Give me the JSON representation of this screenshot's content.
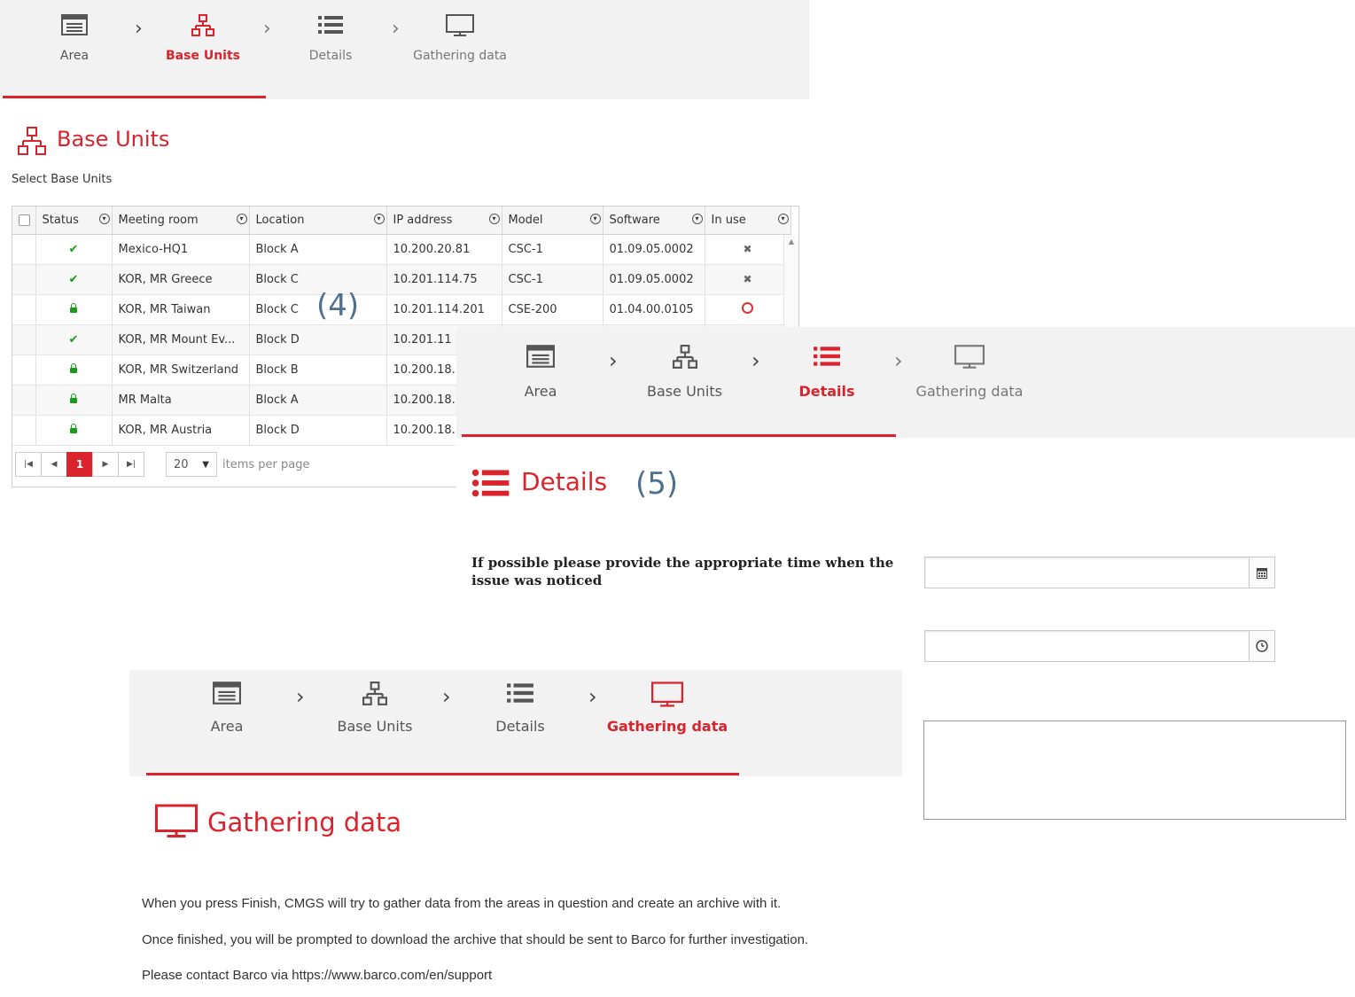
{
  "wizard_steps": [
    "Area",
    "Base Units",
    "Details",
    "Gathering data"
  ],
  "panel1": {
    "active_step": "Base Units",
    "title": "Base Units",
    "subtitle": "Select Base Units",
    "columns": [
      "Status",
      "Meeting room",
      "Location",
      "IP address",
      "Model",
      "Software",
      "In use"
    ],
    "rows": [
      {
        "status": "check",
        "room": "Mexico-HQ1",
        "location": "Block A",
        "ip": "10.200.20.81",
        "model": "CSC-1",
        "software": "01.09.05.0002",
        "in_use": "x"
      },
      {
        "status": "check",
        "room": "KOR, MR Greece",
        "location": "Block C",
        "ip": "10.201.114.75",
        "model": "CSC-1",
        "software": "01.09.05.0002",
        "in_use": "x"
      },
      {
        "status": "lock",
        "room": "KOR, MR Taiwan",
        "location": "Block C",
        "ip": "10.201.114.201",
        "model": "CSE-200",
        "software": "01.04.00.0105",
        "in_use": "ring"
      },
      {
        "status": "check",
        "room": "KOR, MR Mount Ev...",
        "location": "Block D",
        "ip": "10.201.11",
        "model": "",
        "software": "",
        "in_use": ""
      },
      {
        "status": "lock",
        "room": "KOR, MR Switzerland",
        "location": "Block B",
        "ip": "10.200.18.",
        "model": "",
        "software": "",
        "in_use": ""
      },
      {
        "status": "lock",
        "room": "MR Malta",
        "location": "Block A",
        "ip": "10.200.18.",
        "model": "",
        "software": "",
        "in_use": ""
      },
      {
        "status": "lock",
        "room": "KOR, MR Austria",
        "location": "Block D",
        "ip": "10.200.18.",
        "model": "",
        "software": "",
        "in_use": ""
      }
    ],
    "pager": {
      "current_page": "1",
      "page_size": "20",
      "items_label": "items per page"
    },
    "annotation": "(4)"
  },
  "panel2": {
    "active_step": "Details",
    "title": "Details",
    "annotation": "(5)",
    "question": "If possible please provide the appropriate time when the issue was noticed",
    "date_value": "",
    "time_value": "",
    "comment_value": ""
  },
  "panel3": {
    "active_step": "Gathering data",
    "title": "Gathering data",
    "lines": [
      "When you press Finish, CMGS will try to gather data from the areas in question and create an archive with it.",
      "Once finished, you will be prompted to download the archive that should be sent to Barco for further investigation.",
      "Please contact Barco via  https://www.barco.com/en/support"
    ]
  },
  "colors": {
    "accent": "#d9232d",
    "ok": "#1a9a1a",
    "annotation": "#4f6f8f"
  }
}
